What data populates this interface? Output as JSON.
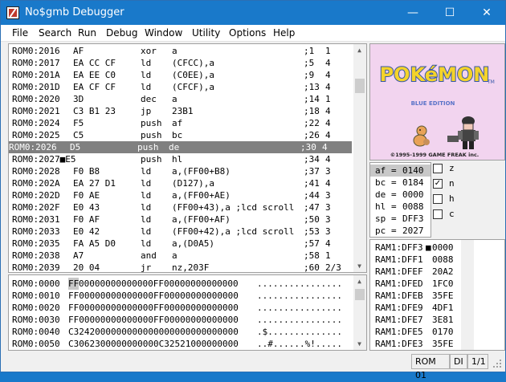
{
  "window": {
    "title": "No$gmb Debugger",
    "min_glyph": "—",
    "max_glyph": "☐",
    "close_glyph": "✕"
  },
  "menu": [
    "File",
    "Search",
    "Run",
    "Debug",
    "Window",
    "Utility",
    "Options",
    "Help"
  ],
  "disassembly": {
    "selected_index": 8,
    "rows": [
      {
        "addr": "ROM0:2016",
        "bytes": "AF",
        "op": "xor",
        "args": "a",
        "comment": ";1",
        "cycles": "1"
      },
      {
        "addr": "ROM0:2017",
        "bytes": "EA CC CF",
        "op": "ld",
        "args": "(CFCC),a",
        "comment": ";5",
        "cycles": "4"
      },
      {
        "addr": "ROM0:201A",
        "bytes": "EA EE C0",
        "op": "ld",
        "args": "(C0EE),a",
        "comment": ";9",
        "cycles": "4"
      },
      {
        "addr": "ROM0:201D",
        "bytes": "EA CF CF",
        "op": "ld",
        "args": "(CFCF),a",
        "comment": ";13",
        "cycles": "4"
      },
      {
        "addr": "ROM0:2020",
        "bytes": "3D",
        "op": "dec",
        "args": "a",
        "comment": ";14",
        "cycles": "1"
      },
      {
        "addr": "ROM0:2021",
        "bytes": "C3 B1 23",
        "op": "jp",
        "args": "23B1",
        "comment": ";18",
        "cycles": "4"
      },
      {
        "addr": "ROM0:2024",
        "bytes": "F5",
        "op": "push",
        "args": "af",
        "comment": ";22",
        "cycles": "4"
      },
      {
        "addr": "ROM0:2025",
        "bytes": "C5",
        "op": "push",
        "args": "bc",
        "comment": ";26",
        "cycles": "4"
      },
      {
        "addr": "ROM0:2026",
        "bytes": "D5",
        "op": "push",
        "args": "de",
        "comment": ";30",
        "cycles": "4"
      },
      {
        "addr": "ROM0:2027■E5",
        "bytes": "",
        "op": "push",
        "args": "hl",
        "comment": ";34",
        "cycles": "4"
      },
      {
        "addr": "ROM0:2028",
        "bytes": "F0 B8",
        "op": "ld",
        "args": "a,(FF00+B8)",
        "comment": ";37",
        "cycles": "3"
      },
      {
        "addr": "ROM0:202A",
        "bytes": "EA 27 D1",
        "op": "ld",
        "args": "(D127),a",
        "comment": ";41",
        "cycles": "4"
      },
      {
        "addr": "ROM0:202D",
        "bytes": "F0 AE",
        "op": "ld",
        "args": "a,(FF00+AE)",
        "comment": ";44",
        "cycles": "3"
      },
      {
        "addr": "ROM0:202F",
        "bytes": "E0 43",
        "op": "ld",
        "args": "(FF00+43),a ;lcd scroll",
        "comment": ";47",
        "cycles": "3"
      },
      {
        "addr": "ROM0:2031",
        "bytes": "F0 AF",
        "op": "ld",
        "args": "a,(FF00+AF)",
        "comment": ";50",
        "cycles": "3"
      },
      {
        "addr": "ROM0:2033",
        "bytes": "E0 42",
        "op": "ld",
        "args": "(FF00+42),a ;lcd scroll",
        "comment": ";53",
        "cycles": "3"
      },
      {
        "addr": "ROM0:2035",
        "bytes": "FA A5 D0",
        "op": "ld",
        "args": "a,(D0A5)",
        "comment": ";57",
        "cycles": "4"
      },
      {
        "addr": "ROM0:2038",
        "bytes": "A7",
        "op": "and",
        "args": "a",
        "comment": ";58",
        "cycles": "1"
      },
      {
        "addr": "ROM0:2039",
        "bytes": "20 04",
        "op": "jr",
        "args": "nz,203F",
        "comment": ";60",
        "cycles": "2/3"
      }
    ]
  },
  "hexdump": {
    "rows": [
      {
        "addr": "ROM0:0000",
        "cursor": "FF",
        "hex": "00000000000000FF00000000000000",
        "ascii": "................"
      },
      {
        "addr": "ROM0:0010",
        "cursor": "",
        "hex": "FF00000000000000FF00000000000000",
        "ascii": "................"
      },
      {
        "addr": "ROM0:0020",
        "cursor": "",
        "hex": "FF00000000000000FF00000000000000",
        "ascii": "................"
      },
      {
        "addr": "ROM0:0030",
        "cursor": "",
        "hex": "FF00000000000000FF00000000000000",
        "ascii": "................"
      },
      {
        "addr": "ROM0:0040",
        "cursor": "",
        "hex": "C3242000000000000000000000000000",
        "ascii": ".$.............."
      },
      {
        "addr": "ROM0:0050",
        "cursor": "",
        "hex": "C3062300000000000C32521000000000",
        "ascii": "..#......%!....."
      }
    ]
  },
  "game_screen": {
    "logo": "POKéMON",
    "tm": "TM",
    "edition": "BLUE EDITION",
    "copyright": "©1995-1999 GAME FREAK inc."
  },
  "registers": [
    {
      "name": "af",
      "value": "0140"
    },
    {
      "name": "bc",
      "value": "0184"
    },
    {
      "name": "de",
      "value": "0000"
    },
    {
      "name": "hl",
      "value": "0088"
    },
    {
      "name": "sp",
      "value": "DFF3"
    },
    {
      "name": "pc",
      "value": "2027"
    }
  ],
  "flags": [
    {
      "name": "z",
      "checked": false,
      "mark": ""
    },
    {
      "name": "n",
      "checked": true,
      "mark": "✓"
    },
    {
      "name": "h",
      "checked": false,
      "mark": ""
    },
    {
      "name": "c",
      "checked": false,
      "mark": ""
    }
  ],
  "stack": {
    "rows": [
      {
        "addr": "RAM1:DFF3",
        "sep": "■",
        "value": "0000"
      },
      {
        "addr": "RAM1:DFF1",
        "sep": " ",
        "value": "0088"
      },
      {
        "addr": "RAM1:DFEF",
        "sep": " ",
        "value": "20A2"
      },
      {
        "addr": "RAM1:DFED",
        "sep": " ",
        "value": "1FC0"
      },
      {
        "addr": "RAM1:DFEB",
        "sep": " ",
        "value": "35FE"
      },
      {
        "addr": "RAM1:DFE9",
        "sep": " ",
        "value": "4DF1"
      },
      {
        "addr": "RAM1:DFE7",
        "sep": " ",
        "value": "3E81"
      },
      {
        "addr": "RAM1:DFE5",
        "sep": " ",
        "value": "0170"
      },
      {
        "addr": "RAM1:DFE3",
        "sep": " ",
        "value": "35FE"
      }
    ]
  },
  "status": {
    "rom_bank": "ROM 01",
    "interrupts": "DI",
    "page": "1/1"
  },
  "colors": {
    "titlebar": "#1979ca",
    "selection": "#808080",
    "screen_bg": "#f2d4ef",
    "logo_yellow": "#f4d32a",
    "logo_blue": "#3556a8"
  }
}
